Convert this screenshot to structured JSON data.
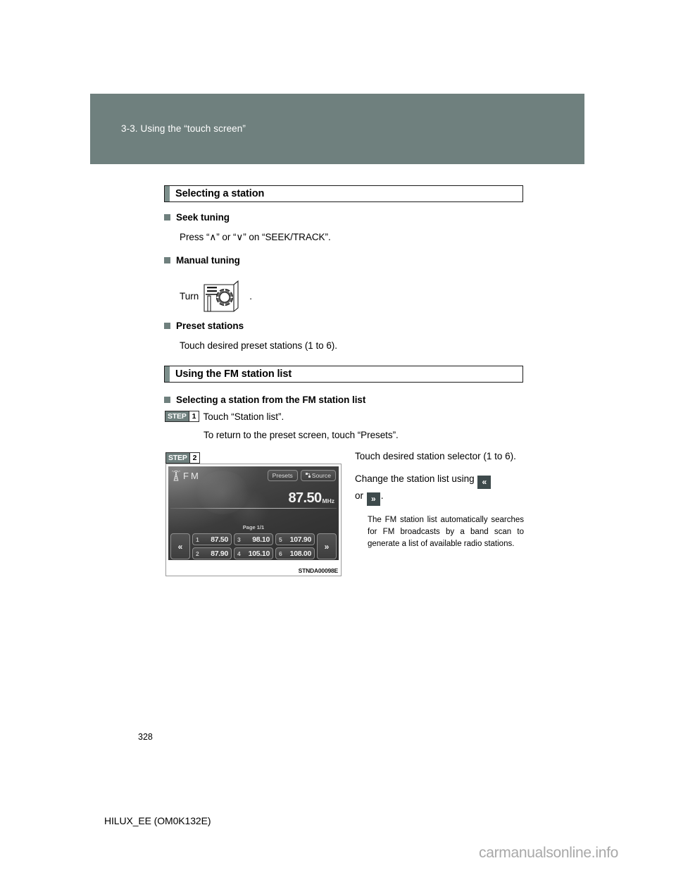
{
  "header": {
    "title": "3-3. Using the “touch screen”",
    "band_color": "#6f807e"
  },
  "sections": [
    {
      "id": "selecting-a-station",
      "title": "Selecting a station",
      "items": [
        {
          "heading": "Seek tuning",
          "body": "Press “∧” or “∨” on “SEEK/TRACK”."
        },
        {
          "heading": "Manual tuning",
          "body": "Turn",
          "body_suffix": "."
        },
        {
          "heading": "Preset stations",
          "body": "Touch desired preset stations (1 to 6)."
        }
      ]
    },
    {
      "id": "using-the-fm-station-list",
      "title": "Using the FM station list",
      "heading": "Selecting a station from the FM station list",
      "step1": {
        "word": "STEP",
        "number": "1",
        "text": "Touch “Station list”.",
        "subtext": "To return to the preset screen, touch “Presets”."
      },
      "step2": {
        "word": "STEP",
        "number": "2"
      }
    }
  ],
  "right_column": {
    "para1": "Touch desired station selector (1 to 6).",
    "para2_prefix": "Change the station list using",
    "para2_icon_left": "«",
    "para2_or": "or",
    "para2_icon_right": "»",
    "para2_suffix": ".",
    "note": "The FM station list automatically searches for FM broadcasts by a band scan to generate a list of available radio stations."
  },
  "radio_screen": {
    "band": "FM",
    "tower_icon": "broadcast-tower-icon",
    "presets_button": "Presets",
    "source_button": "Source",
    "frequency": "87.50",
    "frequency_unit": "MHz",
    "page_indicator": "Page 1/1",
    "prev_arrow": "«",
    "next_arrow": "»",
    "presets": [
      {
        "index": "1",
        "freq": "87.50"
      },
      {
        "index": "2",
        "freq": "87.90"
      },
      {
        "index": "3",
        "freq": "98.10"
      },
      {
        "index": "4",
        "freq": "105.10"
      },
      {
        "index": "5",
        "freq": "107.90"
      },
      {
        "index": "6",
        "freq": "108.00"
      }
    ],
    "figure_code": "STNDA00098E"
  },
  "footer": {
    "page_number": "328",
    "doc_code": "HILUX_EE (OM0K132E)",
    "watermark": "carmanualsonline.info"
  }
}
